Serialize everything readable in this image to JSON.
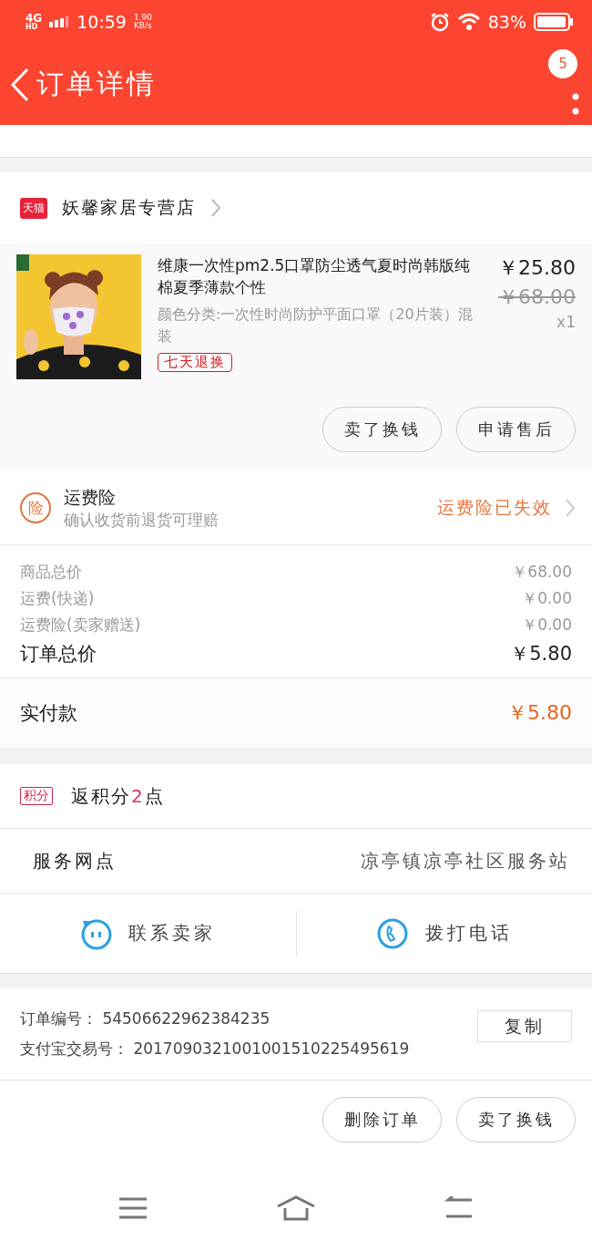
{
  "status_bar": {
    "network": "4G",
    "network_badge": "HD",
    "time": "10:59",
    "speed_value": "1.90",
    "speed_unit": "KB/s",
    "battery": "83%"
  },
  "header": {
    "title": "订单详情",
    "badge": "5"
  },
  "shop": {
    "badge": "天猫",
    "name": "妖馨家居专营店"
  },
  "product": {
    "image": {
      "kind": "picture"
    },
    "title": "维康一次性pm2.5口罩防尘透气夏时尚韩版纯棉夏季薄款个性",
    "variant": "颜色分类:一次性时尚防护平面口罩（20片装）混装",
    "tag": "七天退换",
    "price": "￥25.80",
    "original_price": "￥68.00",
    "quantity": "x1",
    "actions": [
      "卖了换钱",
      "申请售后"
    ]
  },
  "insurance": {
    "icon": "险",
    "title": "运费险",
    "subtitle": "确认收货前退货可理赔",
    "status": "运费险已失效"
  },
  "summary": {
    "rows": [
      {
        "label": "商品总价",
        "value": "￥68.00"
      },
      {
        "label": "运费(快递)",
        "value": "￥0.00"
      },
      {
        "label": "运费险(卖家赠送)",
        "value": "￥0.00"
      }
    ],
    "total": {
      "label": "订单总价",
      "value": "￥5.80"
    }
  },
  "payment": {
    "label": "实付款",
    "amount": "￥5.80"
  },
  "points": {
    "badge": "积分",
    "prefix": "返积分",
    "value": "2",
    "suffix": "点"
  },
  "service": {
    "label": "服务网点",
    "value": "凉亭镇凉亭社区服务站"
  },
  "contact": [
    {
      "kind": "chat",
      "label": "联系卖家"
    },
    {
      "kind": "phone",
      "label": "拨打电话"
    }
  ],
  "order_info": {
    "rows": [
      {
        "label": "订单编号：",
        "value": "54506622962384235"
      },
      {
        "label": "支付宝交易号：",
        "value": "2017090321001001510225495619"
      }
    ],
    "copy_button": "复制"
  },
  "footer_actions": [
    "删除订单",
    "卖了换钱"
  ]
}
